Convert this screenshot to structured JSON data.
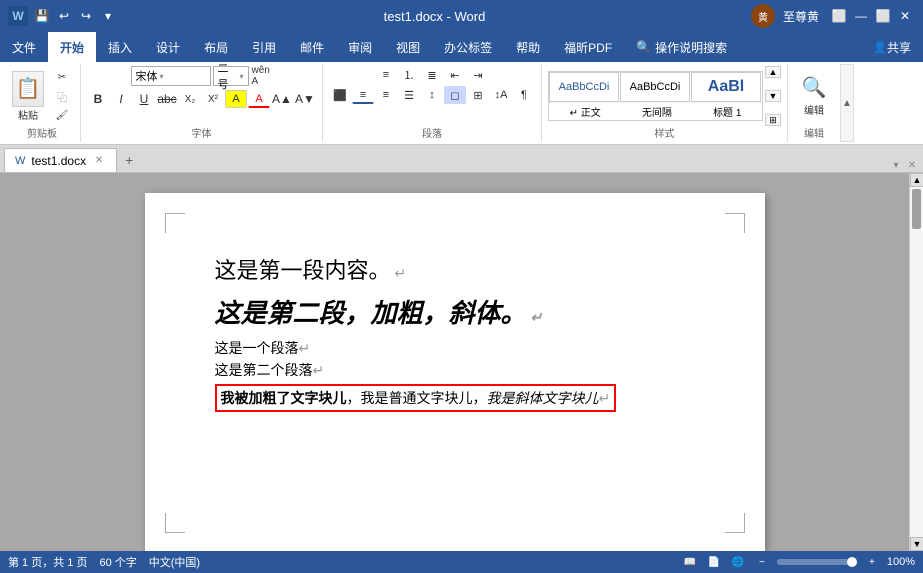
{
  "titleBar": {
    "title": "test1.docx - Word",
    "user": "至尊黄",
    "quickAccess": [
      "💾",
      "↩",
      "↪",
      "▾"
    ]
  },
  "ribbon": {
    "tabs": [
      "文件",
      "开始",
      "插入",
      "设计",
      "布局",
      "引用",
      "邮件",
      "审阅",
      "视图",
      "办公标签",
      "帮助",
      "福昕PDF",
      "操作说明搜索"
    ],
    "activeTab": "开始",
    "clipboard": {
      "label": "剪贴板",
      "paste": "粘贴",
      "cut": "✂",
      "copy": "⿻",
      "formatPainter": "🖌"
    },
    "font": {
      "label": "字体",
      "family": "宋体",
      "size": "二号",
      "wfn": "wên A",
      "bold": "B",
      "italic": "I",
      "underline": "U",
      "strikethrough": "abc",
      "subscript": "X₂",
      "superscript": "X²",
      "highlight": "A",
      "fontColor": "A",
      "fontSize2": "A▲",
      "fontSize3": "A▼"
    },
    "paragraph": {
      "label": "段落"
    },
    "styles": {
      "label": "样式",
      "items": [
        {
          "label": "正文",
          "class": "zhengwen"
        },
        {
          "label": "无间隔",
          "preview": "AaBbCcDd"
        },
        {
          "label": "标题 1",
          "preview": "AaBl"
        }
      ]
    },
    "editing": {
      "label": "编辑",
      "searchIcon": "🔍"
    },
    "share": "共享"
  },
  "docTab": {
    "name": "test1.docx",
    "icon": "W"
  },
  "document": {
    "para1": "这是第一段内容。",
    "para2": "这是第二段，加粗，斜体。",
    "para3": "这是一个段落",
    "para4": "这是第二个段落",
    "para5_bold": "我被加粗了文字块儿",
    "para5_normal": "我是普通文字块儿",
    "para5_italic": "我是斜体文字块儿"
  },
  "statusBar": {
    "page": "第 1 页，共 1 页",
    "words": "60 个字",
    "language": "中文(中国)",
    "zoom": "100%"
  }
}
